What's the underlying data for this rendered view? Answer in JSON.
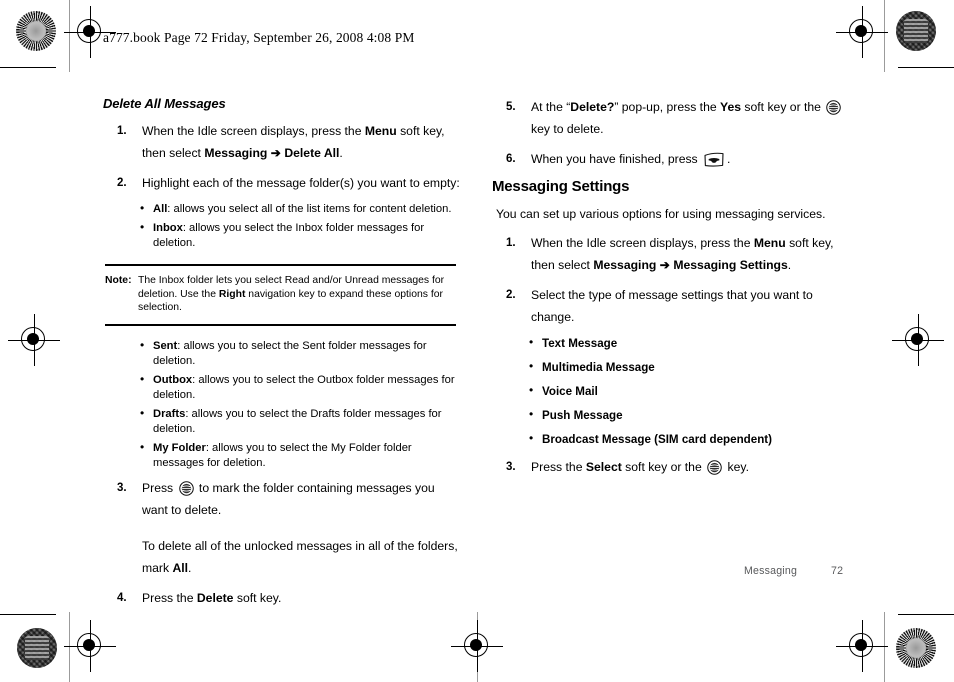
{
  "print_header": "a777.book  Page 72  Friday, September 26, 2008  4:08 PM",
  "icons": {
    "select_key": "select-key-icon",
    "end_call_key": "end-call-key-icon",
    "calibration_burst": "calibration-starburst-target",
    "calibration_maze": "calibration-texture-target",
    "registration": "registration-crosshair-icon"
  },
  "left_column": {
    "heading": "Delete All Messages",
    "steps": [
      {
        "num": "1.",
        "parts": [
          {
            "t": "When the Idle screen displays, press the "
          },
          {
            "t": "Menu",
            "b": true
          },
          {
            "t": " soft key, then select "
          },
          {
            "t": "Messaging",
            "b": true
          },
          {
            "t": " ➔ ",
            "b": true
          },
          {
            "t": "Delete All",
            "b": true
          },
          {
            "t": "."
          }
        ]
      },
      {
        "num": "2.",
        "parts": [
          {
            "t": "Highlight each of the message folder(s) you want to empty:"
          }
        ]
      }
    ],
    "bullets_before_note": [
      {
        "term": "All",
        "desc": ": allows you select all of the list items for content deletion."
      },
      {
        "term": "Inbox",
        "desc": ": allows you select the Inbox folder messages for deletion."
      }
    ],
    "note": {
      "label": "Note:",
      "parts": [
        {
          "t": "The Inbox folder lets you select Read and/or Unread messages for deletion. Use the "
        },
        {
          "t": "Right",
          "b": true
        },
        {
          "t": " navigation key to expand these options for selection."
        }
      ]
    },
    "bullets_after_note": [
      {
        "term": "Sent",
        "desc": ": allows you to select the Sent folder messages for deletion."
      },
      {
        "term": "Outbox",
        "desc": ": allows you to select the Outbox folder messages for deletion."
      },
      {
        "term": "Drafts",
        "desc": ": allows you to select the Drafts folder messages for deletion."
      },
      {
        "term": "My Folder",
        "desc": ": allows you to select the My Folder folder messages for deletion."
      }
    ],
    "steps_tail": [
      {
        "num": "3.",
        "parts": [
          {
            "t": "Press "
          },
          {
            "icon": "select_key"
          },
          {
            "t": " to mark the folder containing messages you want to delete."
          }
        ],
        "para2": [
          {
            "t": "To delete all of the unlocked messages in all of the folders, mark "
          },
          {
            "t": "All",
            "b": true
          },
          {
            "t": "."
          }
        ]
      },
      {
        "num": "4.",
        "parts": [
          {
            "t": "Press the "
          },
          {
            "t": "Delete",
            "b": true
          },
          {
            "t": " soft key."
          }
        ]
      }
    ]
  },
  "right_column": {
    "steps_top": [
      {
        "num": "5.",
        "parts": [
          {
            "t": "At the “"
          },
          {
            "t": "Delete?",
            "b": true
          },
          {
            "t": "” pop-up, press the "
          },
          {
            "t": "Yes",
            "b": true
          },
          {
            "t": " soft key or the "
          },
          {
            "icon": "select_key"
          },
          {
            "t": " key to delete."
          }
        ]
      },
      {
        "num": "6.",
        "parts": [
          {
            "t": "When you have finished, press "
          },
          {
            "icon": "end_call_key"
          },
          {
            "t": "."
          }
        ]
      }
    ],
    "heading": "Messaging Settings",
    "intro": "You can set up various options for using messaging services.",
    "steps": [
      {
        "num": "1.",
        "parts": [
          {
            "t": "When the Idle screen displays, press the "
          },
          {
            "t": "Menu",
            "b": true
          },
          {
            "t": " soft key, then select "
          },
          {
            "t": "Messaging",
            "b": true
          },
          {
            "t": " ➔ ",
            "b": true
          },
          {
            "t": "Messaging Settings",
            "b": true
          },
          {
            "t": "."
          }
        ]
      },
      {
        "num": "2.",
        "parts": [
          {
            "t": "Select the type of message settings that you want to change."
          }
        ]
      }
    ],
    "bullets": [
      "Text Message",
      "Multimedia Message",
      "Voice Mail",
      "Push Message",
      "Broadcast Message (SIM card dependent)"
    ],
    "steps_tail": [
      {
        "num": "3.",
        "parts": [
          {
            "t": "Press the "
          },
          {
            "t": "Select",
            "b": true
          },
          {
            "t": " soft key or the "
          },
          {
            "icon": "select_key"
          },
          {
            "t": " key."
          }
        ]
      }
    ]
  },
  "footer": {
    "section": "Messaging",
    "page": "72"
  }
}
